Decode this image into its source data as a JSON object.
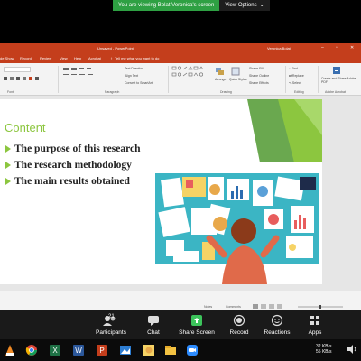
{
  "share_banner": {
    "viewing_text": "You are viewing Bolat Veronica's screen",
    "view_options_label": "View Options",
    "chevron": "⌄"
  },
  "ppt": {
    "title": "Unsaved - PowerPoint",
    "user": "Veronica Bolat",
    "tabs": [
      "de Show",
      "Record",
      "Review",
      "View",
      "Help",
      "Acrobat"
    ],
    "tell_me": "Tell me what you want to do",
    "ribbon": {
      "text_direction": "Text Direction",
      "align_text": "Align Text",
      "convert_smartart": "Convert to SmartArt",
      "arrange": "Arrange",
      "quick_styles": "Quick Styles",
      "shape_fill": "Shape Fill",
      "shape_outline": "Shape Outline",
      "shape_effects": "Shape Effects",
      "find": "Find",
      "replace": "Replace",
      "select": "Select",
      "create_share": "Create and Share Adobe PDF",
      "groups": {
        "font": "Font",
        "paragraph": "Paragraph",
        "drawing": "Drawing",
        "editing": "Editing",
        "adobe": "Adobe Acrobat"
      }
    },
    "slide": {
      "title": "Content",
      "bullets": [
        "The purpose of this research",
        "The research methodology",
        "The main results obtained"
      ]
    },
    "status": {
      "notes": "Notes",
      "comments": "Comments"
    }
  },
  "zoom_toolbar": {
    "participants_label": "Participants",
    "participants_count": "21",
    "chat_label": "Chat",
    "share_label": "Share Screen",
    "record_label": "Record",
    "reactions_label": "Reactions",
    "apps_label": "Apps"
  },
  "taskbar": {
    "net_up": "32 KB/s",
    "net_down": "55 KB/s"
  },
  "colors": {
    "ppt_red": "#c43e1c",
    "slide_accent_green": "#8cc63f",
    "zoom_green": "#2ea043",
    "share_green": "#3cc35b"
  }
}
